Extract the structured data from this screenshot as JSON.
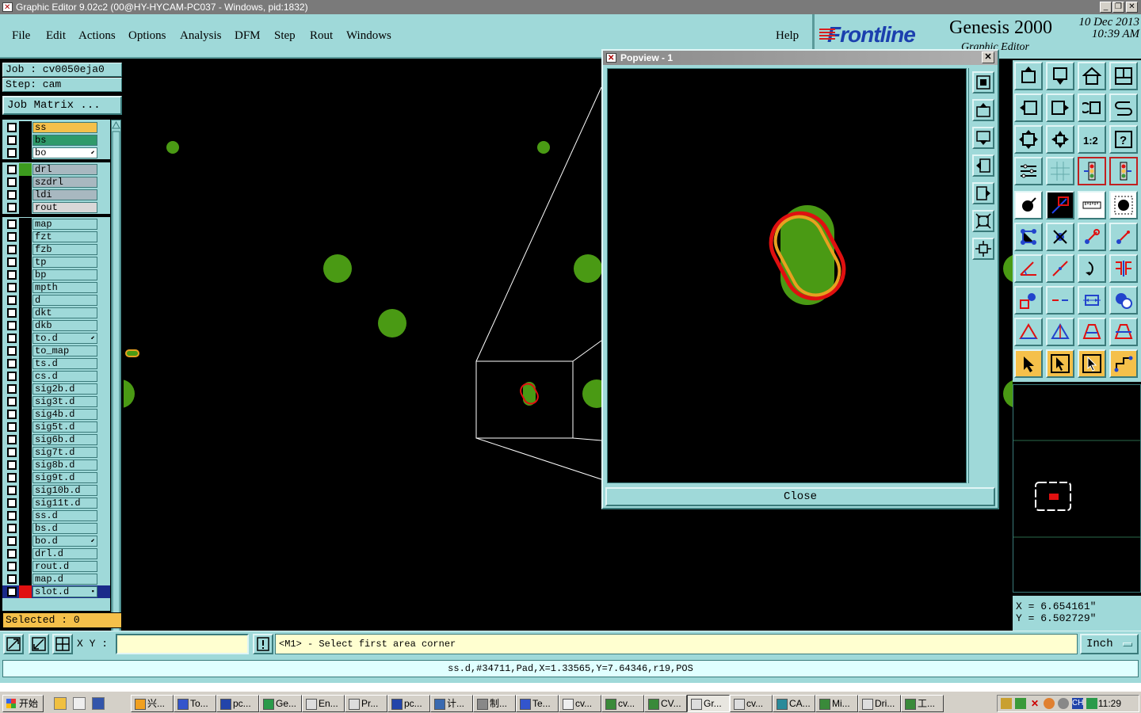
{
  "window": {
    "title": "Graphic Editor 9.02c2 (00@HY-HYCAM-PC037 - Windows, pid:1832)",
    "controls": [
      "_",
      "❐",
      "✕"
    ]
  },
  "menu": [
    "File",
    "Edit",
    "Actions",
    "Options",
    "Analysis",
    "DFM",
    "Step",
    "Rout",
    "Windows"
  ],
  "help": "Help",
  "brand": {
    "logo": "Frontline",
    "product": "Genesis 2000",
    "date_line1": "10 Dec 2013",
    "date_line2": "10:39 AM",
    "subtitle": "Graphic Editor"
  },
  "job": {
    "job_label": "Job : cv0050eja0",
    "step_label": "Step: cam",
    "job_matrix": "Job Matrix ..."
  },
  "layers": [
    {
      "name": "ss",
      "group": 0,
      "color": "#f5c04a",
      "bg": "#f5c04a"
    },
    {
      "name": "bs",
      "group": 0,
      "color": "#2f9a6a",
      "bg": "#2f9a6a"
    },
    {
      "name": "bo",
      "group": 0,
      "color": "#ffffff",
      "bg": "#ffffff",
      "flag": "⬋"
    },
    {
      "name": "drl",
      "group": 1,
      "color": "#3c9b1e",
      "bg": "#a8b8c0",
      "marked": true
    },
    {
      "name": "szdrl",
      "group": 1,
      "bg": "#a8b8c0"
    },
    {
      "name": "ldi",
      "group": 1,
      "bg": "#a8b8c0"
    },
    {
      "name": "rout",
      "group": 1,
      "bg": "#d8d8d8"
    },
    {
      "name": "map",
      "group": 2
    },
    {
      "name": "fzt",
      "group": 2
    },
    {
      "name": "fzb",
      "group": 2
    },
    {
      "name": "tp",
      "group": 2
    },
    {
      "name": "bp",
      "group": 2
    },
    {
      "name": "mpth",
      "group": 2
    },
    {
      "name": "d",
      "group": 2
    },
    {
      "name": "dkt",
      "group": 2
    },
    {
      "name": "dkb",
      "group": 2
    },
    {
      "name": "to.d",
      "group": 2,
      "flag": "⬋"
    },
    {
      "name": "to_map",
      "group": 2
    },
    {
      "name": "ts.d",
      "group": 2
    },
    {
      "name": "cs.d",
      "group": 2
    },
    {
      "name": "sig2b.d",
      "group": 2
    },
    {
      "name": "sig3t.d",
      "group": 2
    },
    {
      "name": "sig4b.d",
      "group": 2
    },
    {
      "name": "sig5t.d",
      "group": 2
    },
    {
      "name": "sig6b.d",
      "group": 2
    },
    {
      "name": "sig7t.d",
      "group": 2
    },
    {
      "name": "sig8b.d",
      "group": 2
    },
    {
      "name": "sig9t.d",
      "group": 2
    },
    {
      "name": "sig10b.d",
      "group": 2
    },
    {
      "name": "sig11t.d",
      "group": 2
    },
    {
      "name": "ss.d",
      "group": 2
    },
    {
      "name": "bs.d",
      "group": 2
    },
    {
      "name": "bo.d",
      "group": 2,
      "flag": "⬋"
    },
    {
      "name": "drl.d",
      "group": 2
    },
    {
      "name": "rout.d",
      "group": 2
    },
    {
      "name": "map.d",
      "group": 2
    },
    {
      "name": "slot.d",
      "group": 2,
      "marked": true,
      "color": "#e01010",
      "selected": true,
      "flag": "▪"
    }
  ],
  "selected_label": "Selected : 0",
  "popview": {
    "title": "Popview - 1",
    "close_label": "Close"
  },
  "coords": {
    "x": "X = 6.654161\"",
    "y": "Y = 6.502729\""
  },
  "cmd": {
    "xy_label": "X Y :",
    "xy_value": "",
    "message": "<M1> - Select first area corner",
    "units": "Inch"
  },
  "status": "ss.d,#34711,Pad,X=1.33565,Y=7.64346,r19,POS",
  "taskbar": {
    "start": "开始",
    "buttons": [
      {
        "label": "兴...",
        "w": 50,
        "ic": "#f0a020"
      },
      {
        "label": "To...",
        "w": 50,
        "ic": "#3355cc"
      },
      {
        "label": "pc...",
        "w": 50,
        "ic": "#2244aa"
      },
      {
        "label": "Ge...",
        "w": 50,
        "ic": "#2a9a4a"
      },
      {
        "label": "En...",
        "w": 50,
        "ic": "#dddddd"
      },
      {
        "label": "Pr...",
        "w": 50,
        "ic": "#dddddd"
      },
      {
        "label": "pc...",
        "w": 50,
        "ic": "#2244aa"
      },
      {
        "label": "计...",
        "w": 50,
        "ic": "#3a6ab0"
      },
      {
        "label": "制...",
        "w": 50,
        "ic": "#888888"
      },
      {
        "label": "Te...",
        "w": 50,
        "ic": "#3355cc"
      },
      {
        "label": "cv...",
        "w": 50,
        "ic": "#eeeeee"
      },
      {
        "label": "cv...",
        "w": 50,
        "ic": "#3a8a3a"
      },
      {
        "label": "CV...",
        "w": 50,
        "ic": "#3a8a3a"
      },
      {
        "label": "Gr...",
        "w": 50,
        "ic": "#dddddd",
        "active": true
      },
      {
        "label": "cv...",
        "w": 50,
        "ic": "#dddddd"
      },
      {
        "label": "CA...",
        "w": 50,
        "ic": "#2a8a9a"
      },
      {
        "label": "Mi...",
        "w": 50,
        "ic": "#3a8a3a"
      },
      {
        "label": "Dri...",
        "w": 50,
        "ic": "#dddddd"
      },
      {
        "label": "工...",
        "w": 50,
        "ic": "#3a8a3a"
      }
    ],
    "clock": "11:29",
    "tray_ch": "CH"
  }
}
